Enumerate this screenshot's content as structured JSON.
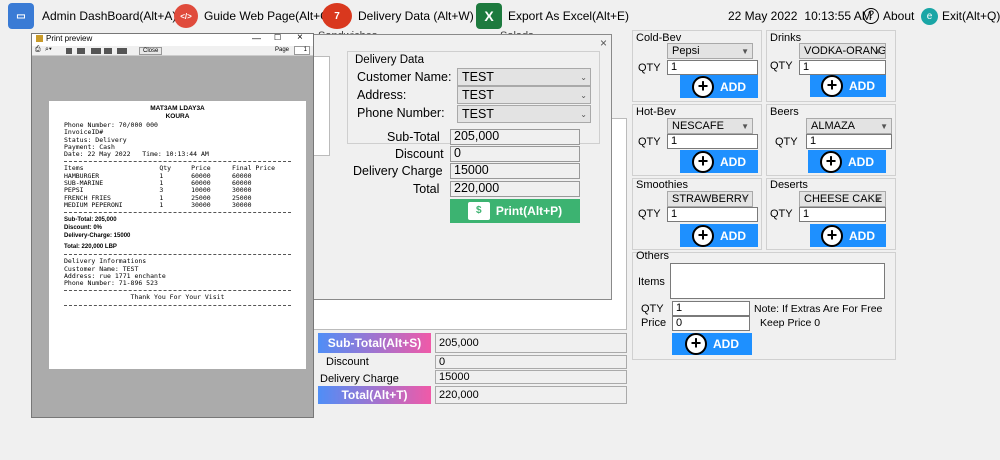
{
  "toolbar": {
    "admin": "Admin DashBoard(Alt+A)",
    "guide": "Guide Web Page(Alt+G)",
    "delivery": "Delivery Data (Alt+W)",
    "excel": "Export As Excel(Alt+E)",
    "date": "22 May 2022",
    "time": "10:13:55 AM",
    "about": "About",
    "exit": "Exit(Alt+Q)"
  },
  "bg_tabs": {
    "sandwiches": "Sandwiches",
    "salads": "Salads"
  },
  "categories": {
    "cold_bev": {
      "title": "Cold-Bev",
      "selected": "Pepsi",
      "qty": "1"
    },
    "drinks": {
      "title": "Drinks",
      "selected": "VODKA-ORANGE",
      "qty": "1"
    },
    "hot_bev": {
      "title": "Hot-Bev",
      "selected": "NESCAFE",
      "qty": "1"
    },
    "beers": {
      "title": "Beers",
      "selected": "ALMAZA",
      "qty": "1"
    },
    "smoothies": {
      "title": "Smoothies",
      "selected": "STRAWBERRY",
      "qty": "1"
    },
    "deserts": {
      "title": "Deserts",
      "selected": "CHEESE CAKE",
      "qty": "1"
    },
    "qty_label": "QTY",
    "add_label": "ADD"
  },
  "others": {
    "title": "Others",
    "items_label": "Items",
    "items_value": "",
    "qty_label": "QTY",
    "qty_value": "1",
    "price_label": "Price",
    "price_value": "0",
    "note1": "Note: If Extras Are For Free",
    "note2": "Keep Price 0",
    "add_label": "ADD"
  },
  "bottom_totals": {
    "subtotal_btn": "Sub-Total(Alt+S)",
    "subtotal_value": "205,000",
    "discount_label": "Discount",
    "discount_value": "0",
    "delivery_label": "Delivery Charge",
    "delivery_value": "15000",
    "total_btn": "Total(Alt+T)",
    "total_value": "220,000"
  },
  "delivery_window": {
    "group_title": "Delivery Data",
    "customer_label": "Customer Name:",
    "customer_value": "TEST",
    "address_label": "Address:",
    "address_value": "TEST",
    "phone_label": "Phone Number:",
    "phone_value": "TEST",
    "subtotal_label": "Sub-Total",
    "subtotal_value": "205,000",
    "discount_label": "Discount",
    "discount_value": "0",
    "delivery_label": "Delivery Charge",
    "delivery_value": "15000",
    "total_label": "Total",
    "total_value": "220,000",
    "print_btn": "Print(Alt+P)",
    "close_glyph": "×"
  },
  "print_preview": {
    "title": "Print preview",
    "close_btn": "Close",
    "page_label": "Page",
    "page_value": "1",
    "receipt": {
      "shop_name": "MAT3AM LDAY3A",
      "location": "KOURA",
      "phone": "Phone Number: 70/000 000",
      "invoice": "InvoiceID#",
      "status": "Status: Delivery",
      "payment": "Payment: Cash",
      "date": "Date: 22 May 2022   Time: 10:13:44 AM",
      "columns": [
        "Items",
        "Qty",
        "Price",
        "Final Price"
      ],
      "rows": [
        [
          "HAMBURGER",
          "1",
          "60000",
          "60000"
        ],
        [
          "SUB-MARINE",
          "1",
          "60000",
          "60000"
        ],
        [
          "PEPSI",
          "3",
          "10000",
          "30000"
        ],
        [
          "FRENCH FRIES",
          "1",
          "25000",
          "25000"
        ],
        [
          "MEDIUM PEPERONI",
          "1",
          "30000",
          "30000"
        ]
      ],
      "subtotal": "Sub-Total: 205,000",
      "discount": "Discount: 0%",
      "delivery_charge": "Delivery-Charge: 15000",
      "total": "Total: 220,000 LBP",
      "delivery_info": "Delivery Informations",
      "customer": "Customer Name: TEST",
      "address": "Address: rue 1771 enchante",
      "cust_phone": "Phone Number: 71-896 523",
      "thanks": "Thank You For Your Visit"
    }
  },
  "colors": {
    "accent_blue": "#1e90ff",
    "print_green": "#3cb371",
    "subtotal_gradient_from": "#4f8ef7",
    "subtotal_gradient_to": "#f05aa8"
  }
}
